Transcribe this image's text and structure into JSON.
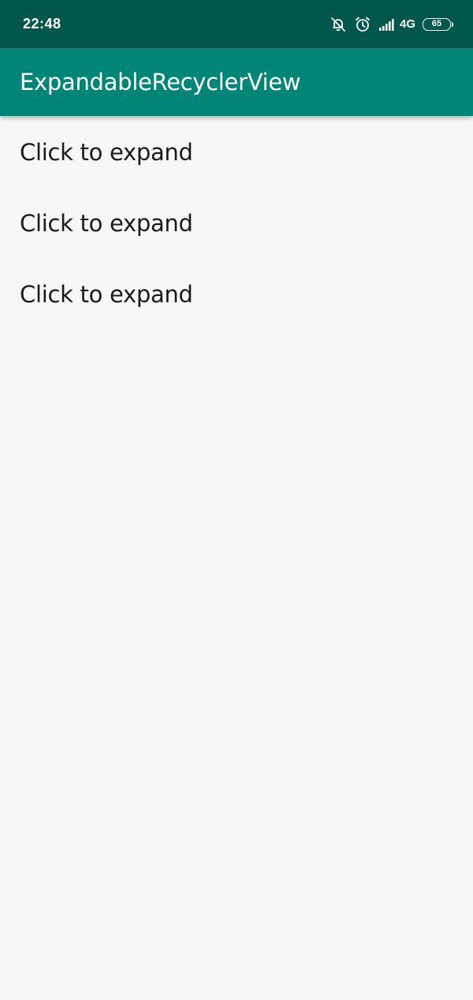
{
  "status_bar": {
    "time": "22:48",
    "icons": [
      "notifications-off-icon",
      "alarm-icon",
      "signal-icon"
    ],
    "network_label": "4G",
    "battery_level": "65"
  },
  "app_bar": {
    "title": "ExpandableRecyclerView"
  },
  "list": {
    "items": [
      {
        "label": "Click to expand"
      },
      {
        "label": "Click to expand"
      },
      {
        "label": "Click to expand"
      }
    ]
  },
  "colors": {
    "status_bar": "#01574b",
    "app_bar": "#008577",
    "background": "#f7f8f6",
    "text": "#1a1a1a"
  }
}
